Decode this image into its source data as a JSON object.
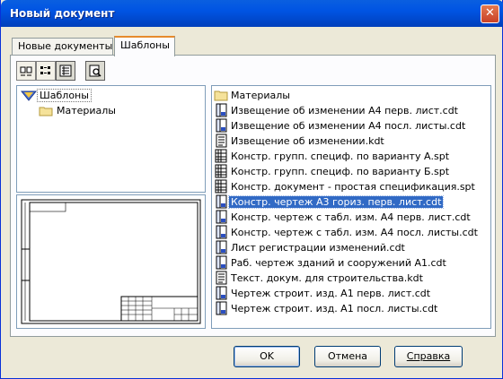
{
  "window": {
    "title": "Новый документ",
    "close_glyph": "✕"
  },
  "tabs": [
    {
      "label": "Новые документы",
      "active": false
    },
    {
      "label": "Шаблоны",
      "active": true
    }
  ],
  "toolbar": {
    "icons": [
      "large-icons-view-icon",
      "small-icons-view-icon",
      "list-view-icon",
      "preview-toggle-icon"
    ]
  },
  "tree": [
    {
      "label": "Шаблоны",
      "icon": "templates-folder-icon",
      "selected": true
    },
    {
      "label": "Материалы",
      "icon": "folder-icon",
      "selected": false
    }
  ],
  "files": [
    {
      "name": "Материалы",
      "type": "folder"
    },
    {
      "name": "Извещение об изменении А4 перв. лист.cdt",
      "type": "cdt"
    },
    {
      "name": "Извещение об изменении А4 посл. листы.cdt",
      "type": "cdt"
    },
    {
      "name": "Извещение об изменении.kdt",
      "type": "kdt"
    },
    {
      "name": "Констр. групп. специф. по варианту А.spt",
      "type": "spt"
    },
    {
      "name": "Констр. групп. специф. по варианту Б.spt",
      "type": "spt"
    },
    {
      "name": "Констр. документ - простая спецификация.spt",
      "type": "spt"
    },
    {
      "name": "Констр. чертеж А3 гориз. перв. лист.cdt",
      "type": "cdt",
      "selected": true
    },
    {
      "name": "Констр. чертеж с табл. изм. А4 перв. лист.cdt",
      "type": "cdt"
    },
    {
      "name": "Констр. чертеж с табл. изм. А4 посл. листы.cdt",
      "type": "cdt"
    },
    {
      "name": "Лист регистрации изменений.cdt",
      "type": "cdt"
    },
    {
      "name": "Раб. чертеж зданий и сооружений А1.cdt",
      "type": "cdt"
    },
    {
      "name": "Текст. докум. для строительства.kdt",
      "type": "kdt"
    },
    {
      "name": "Чертеж  строит. изд. А1 перв. лист.cdt",
      "type": "cdt"
    },
    {
      "name": "Чертеж  строит. изд. А1 посл. листы.cdt",
      "type": "cdt"
    }
  ],
  "buttons": {
    "ok": "OK",
    "cancel": "Отмена",
    "help": "Справка"
  },
  "colors": {
    "title_bar": "#0054e3",
    "selection": "#316ac5",
    "dialog_bg": "#ece9d8"
  }
}
